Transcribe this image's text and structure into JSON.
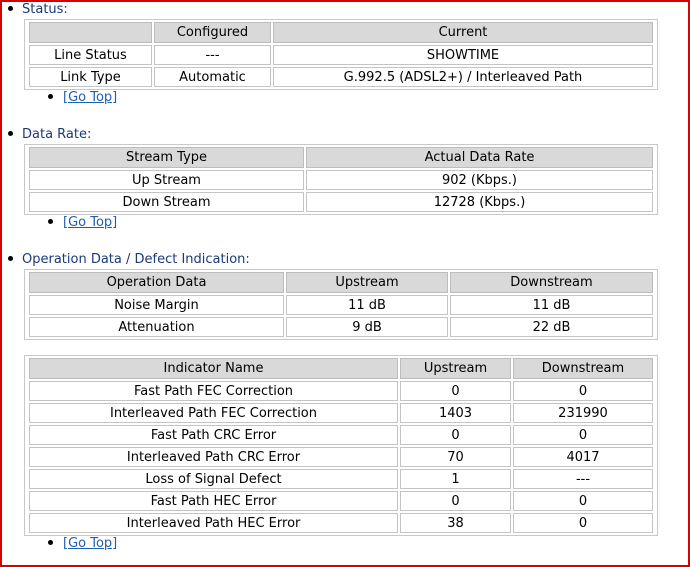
{
  "status": {
    "title": "Status:",
    "headers": [
      "",
      "Configured",
      "Current"
    ],
    "rows": [
      [
        "Line Status",
        "---",
        "SHOWTIME"
      ],
      [
        "Link Type",
        "Automatic",
        "G.992.5 (ADSL2+) / Interleaved Path"
      ]
    ],
    "go_top": "[Go Top]"
  },
  "data_rate": {
    "title": "Data Rate:",
    "headers": [
      "Stream Type",
      "Actual Data Rate"
    ],
    "rows": [
      [
        "Up Stream",
        "902 (Kbps.)"
      ],
      [
        "Down Stream",
        "12728 (Kbps.)"
      ]
    ],
    "go_top": "[Go Top]"
  },
  "operation": {
    "title": "Operation Data / Defect Indication:",
    "headers": [
      "Operation Data",
      "Upstream",
      "Downstream"
    ],
    "rows": [
      [
        "Noise Margin",
        "11 dB",
        "11 dB"
      ],
      [
        "Attenuation",
        "9 dB",
        "22 dB"
      ]
    ]
  },
  "indicators": {
    "headers": [
      "Indicator Name",
      "Upstream",
      "Downstream"
    ],
    "rows": [
      [
        "Fast Path FEC Correction",
        "0",
        "0"
      ],
      [
        "Interleaved Path FEC Correction",
        "1403",
        "231990"
      ],
      [
        "Fast Path CRC Error",
        "0",
        "0"
      ],
      [
        "Interleaved Path CRC Error",
        "70",
        "4017"
      ],
      [
        "Loss of Signal Defect",
        "1",
        "---"
      ],
      [
        "Fast Path HEC Error",
        "0",
        "0"
      ],
      [
        "Interleaved Path HEC Error",
        "38",
        "0"
      ]
    ],
    "go_top": "[Go Top]"
  }
}
